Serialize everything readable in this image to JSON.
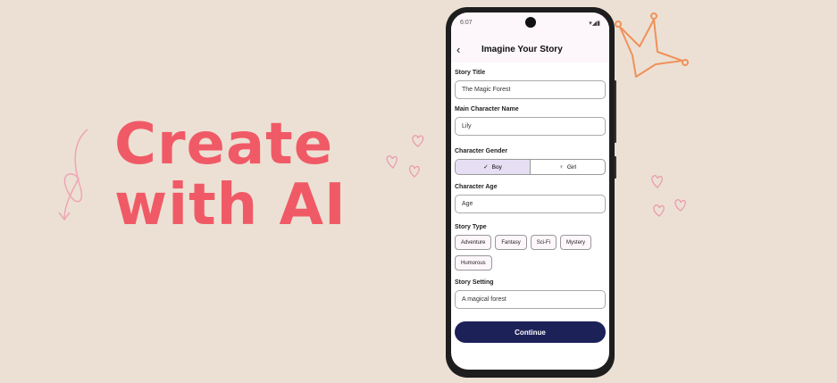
{
  "hero": {
    "line1": "Create",
    "line2": "with AI",
    "color": "#f05a66"
  },
  "status": {
    "time": "6:07",
    "icons": "wifi-signal-battery"
  },
  "header": {
    "title": "Imagine Your Story",
    "back_icon": "chevron-left-icon"
  },
  "form": {
    "story_title": {
      "label": "Story Title",
      "value": "The Magic Forest"
    },
    "character_name": {
      "label": "Main Character Name",
      "value": "Lily"
    },
    "gender": {
      "label": "Character Gender",
      "options": [
        "Boy",
        "Girl"
      ],
      "selected": "Boy"
    },
    "age": {
      "label": "Character Age",
      "placeholder": "Age"
    },
    "story_type": {
      "label": "Story Type",
      "options": [
        "Adventure",
        "Fantasy",
        "Sci-Fi",
        "Mystery",
        "Humorous"
      ]
    },
    "setting": {
      "label": "Story Setting",
      "value": "A magical forest"
    },
    "continue_label": "Continue"
  },
  "colors": {
    "button": "#1c2158",
    "selected_segment": "#e6dff4",
    "background": "#ece0d4"
  }
}
